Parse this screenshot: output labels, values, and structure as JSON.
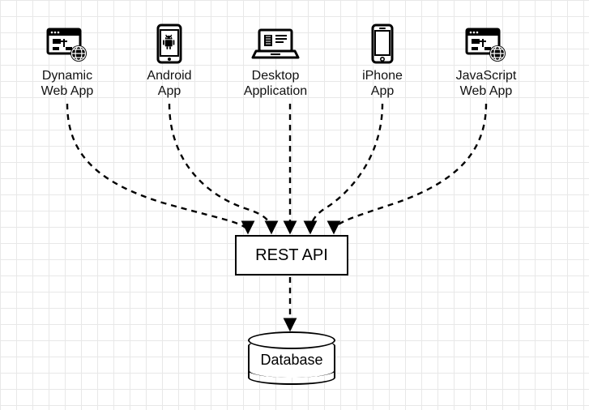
{
  "diagram": {
    "clients": [
      {
        "id": "dynamic-web-app",
        "label": "Dynamic\nWeb App",
        "icon": "browser-globe"
      },
      {
        "id": "android-app",
        "label": "Android\nApp",
        "icon": "android-phone"
      },
      {
        "id": "desktop-app",
        "label": "Desktop\nApplication",
        "icon": "laptop"
      },
      {
        "id": "iphone-app",
        "label": "iPhone\nApp",
        "icon": "iphone"
      },
      {
        "id": "javascript-web-app",
        "label": "JavaScript\nWeb App",
        "icon": "browser-globe"
      }
    ],
    "rest_api": {
      "label": "REST API"
    },
    "database": {
      "label": "Database"
    }
  }
}
